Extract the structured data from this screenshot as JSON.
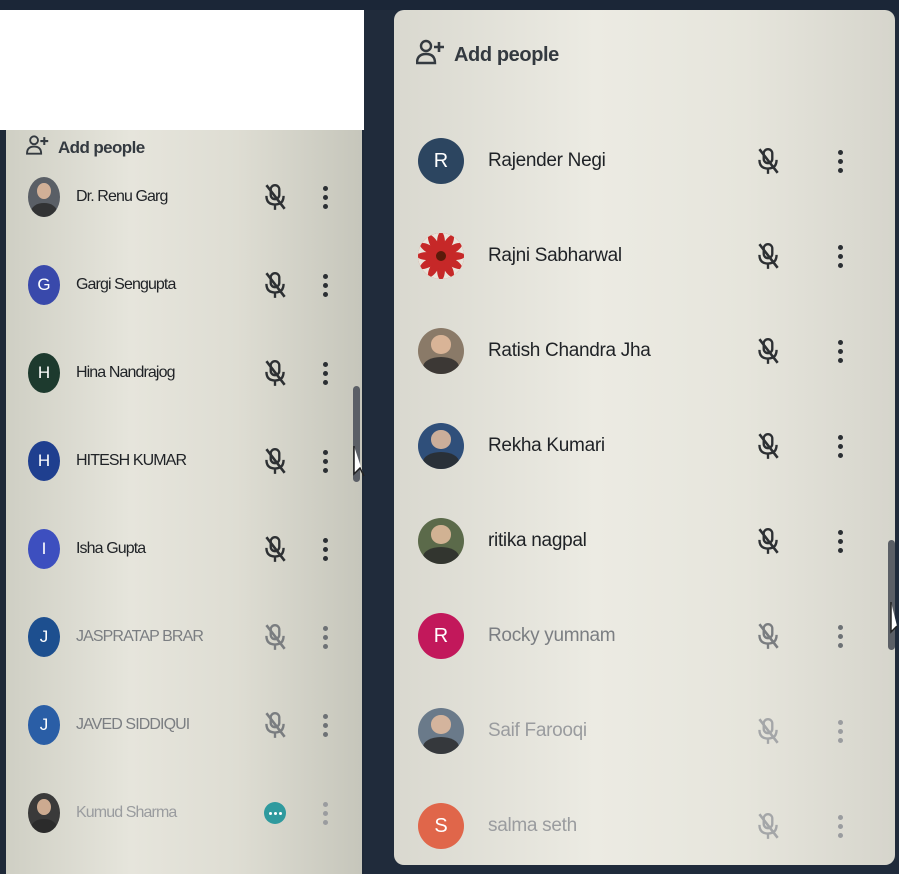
{
  "left_panel": {
    "add_people_label": "Add people",
    "participants": [
      {
        "name": "Dr. Renu Garg",
        "initial": "",
        "avatar_color": "#5a5f66",
        "photo": true
      },
      {
        "name": "Gargi Sengupta",
        "initial": "G",
        "avatar_color": "#3949ab"
      },
      {
        "name": "Hina Nandrajog",
        "initial": "H",
        "avatar_color": "#1d3a2e"
      },
      {
        "name": "HITESH KUMAR",
        "initial": "H",
        "avatar_color": "#1f3f8f"
      },
      {
        "name": "Isha Gupta",
        "initial": "I",
        "avatar_color": "#3d4fbf"
      },
      {
        "name": "JASPRATAP BRAR",
        "initial": "J",
        "avatar_color": "#1d4f8f"
      },
      {
        "name": "JAVED SIDDIQUI",
        "initial": "J",
        "avatar_color": "#2a5ea6"
      },
      {
        "name": "Kumud Sharma",
        "initial": "",
        "avatar_color": "#3a3a3a",
        "photo": true,
        "talking": true
      }
    ]
  },
  "right_panel": {
    "add_people_label": "Add people",
    "participants": [
      {
        "name": "Rajender Negi",
        "initial": "R",
        "avatar_color": "#2c4560"
      },
      {
        "name": "Rajni Sabharwal",
        "initial": "",
        "avatar_color": "#c0392b",
        "flower": true
      },
      {
        "name": "Ratish Chandra Jha",
        "initial": "",
        "avatar_color": "#8a7a68",
        "photo": true
      },
      {
        "name": "Rekha Kumari",
        "initial": "",
        "avatar_color": "#2f4f7a",
        "photo": true
      },
      {
        "name": "ritika nagpal",
        "initial": "",
        "avatar_color": "#5b6a4a",
        "photo": true
      },
      {
        "name": "Rocky yumnam",
        "initial": "R",
        "avatar_color": "#c2185b"
      },
      {
        "name": "Saif Farooqi",
        "initial": "",
        "avatar_color": "#6a7a8a",
        "photo": true
      },
      {
        "name": "salma seth",
        "initial": "S",
        "avatar_color": "#e0664a"
      }
    ]
  }
}
